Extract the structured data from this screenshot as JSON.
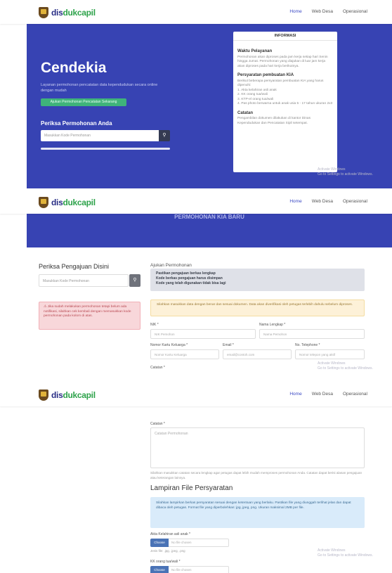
{
  "brand": {
    "part1": "dis",
    "part2": "dukcapil"
  },
  "nav": {
    "items": [
      "Home",
      "Web Desa",
      "Operasional"
    ]
  },
  "hero": {
    "title": "Cendekia",
    "subtitle": "Layanan permohonan pencatatan data kependudukan secara online dengan mudah",
    "cta": "Ajukan Permohonan Pencatatan Sekarang",
    "check_title": "Periksa Permohonan Anda",
    "check_placeholder": "Masukkan Kode Permohonan",
    "search_icon": "search-icon"
  },
  "info_card": {
    "header": "INFORMASI",
    "h1": "Waktu Pelayanan",
    "p1": "Permohonan akan diproses pada jam kerja setiap hari Senin hingga Jumat. Permohonan yang diajukan di luar jam kerja akan diproses pada hari kerja berikutnya.",
    "h2": "Persyaratan pembuatan KIA",
    "p2": "Berikut beberapa persyaratan pembuatan KIA yang harus dipenuhi:",
    "list": [
      "1. Akta kelahiran asli anak",
      "2. KK orang tua/wali",
      "3. KTP-el orang tua/wali",
      "4. Pas photo berwarna untuk anak usia 5 - 17 tahun ukuran 2x3"
    ],
    "h3": "Catatan",
    "p3": "Pengambilan dokumen dilakukan di kantor Dinas Kependudukan dan Pencatatan Sipil setempat."
  },
  "watermark": {
    "line1": "Activate Windows",
    "line2": "Go to Settings to activate Windows."
  },
  "section2": {
    "banner_text": "PERMOHONAN KIA BARU",
    "left_title": "Periksa Pengajuan Disini",
    "left_placeholder": "Masukkan Kode Permohonan",
    "alert": "Jika sudah melakukan permohonan tetapi belum ada notifikasi, silahkan cek kembali dengan memasukkan kode permohonan pada kolom di atas.",
    "form_title": "Ajukan Permohonan",
    "syarat": [
      "Pastikan pengajuan berkas lengkap",
      "Kode berkas pengajuan harus disimpan",
      "Kode yang telah digunakan tidak bisa lagi"
    ],
    "warning": "Silahkan masukkan data dengan benar dan sesuai dokumen. Data akan diverifikasi oleh petugas terlebih dahulu sebelum diproses.",
    "fields": {
      "nik_label": "NIK *",
      "nik_ph": "NIK Pemohon",
      "nama_label": "Nama Lengkap *",
      "nama_ph": "Nama Pemohon",
      "nokk_label": "Nomor Kartu Keluarga *",
      "nokk_ph": "Nomor Kartu Keluarga",
      "email_label": "Email *",
      "email_ph": "email@contoh.com",
      "telp_label": "No. Telephone *",
      "telp_ph": "Nomor telepon yang aktif",
      "catatan_label": "Catatan *"
    }
  },
  "section3": {
    "catatan_label": "Catatan *",
    "catatan_ph": "Catatan Permohonan",
    "muted": "Silahkan masukkan catatan secara lengkap agar petugas dapat lebih mudah memproses permohonan Anda. Catatan dapat berisi alasan pengajuan atau keterangan lainnya.",
    "lamp_title": "Lampiran File Persyaratan",
    "lamp_info": "Silahkan lampirkan berkas persyaratan sesuai dengan ketentuan yang berlaku. Pastikan file yang diunggah terlihat jelas dan dapat dibaca oleh petugas. Format file yang diperbolehkan: jpg, jpeg, png. Ukuran maksimal 2MB per file.",
    "file1_label": "Akta Kelahiran asli anak *",
    "file_btn": "Choose",
    "file_ph": "No file chosen",
    "hint": "Jenis file: .jpg, .jpeg, .png",
    "file2_label": "KK orang tua/wali *"
  }
}
